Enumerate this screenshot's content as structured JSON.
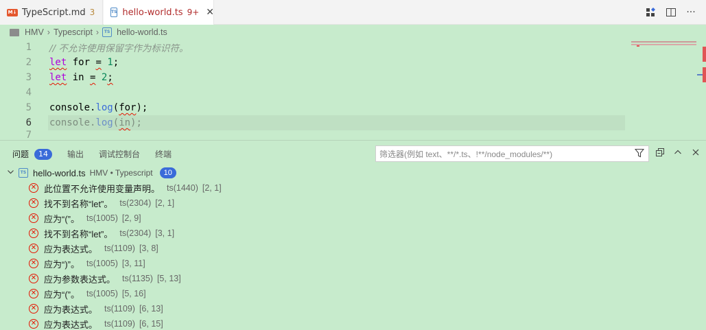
{
  "tabs": [
    {
      "name": "TypeScript.md",
      "badge": "3",
      "icon": "md-icon"
    },
    {
      "name": "hello-world.ts",
      "badge": "9+",
      "icon": "ts-icon",
      "close": "✕"
    }
  ],
  "breadcrumb": [
    "HMV",
    "Typescript",
    "hello-world.ts"
  ],
  "editor": {
    "lines": [
      {
        "num": "1",
        "text": "// 不允许使用保留字作为标识符。"
      },
      {
        "num": "2",
        "kw": "let",
        "id": "for",
        "op": "=",
        "val": "1",
        "end": ";"
      },
      {
        "num": "3",
        "kw": "let",
        "id": "in",
        "op": "=",
        "val": "2",
        "end": ";"
      },
      {
        "num": "4"
      },
      {
        "num": "5",
        "obj": "console",
        "dot": ".",
        "fn": "log",
        "open": "(",
        "arg": "for",
        "close": ");"
      },
      {
        "num": "6",
        "obj": "console",
        "dot": ".",
        "fn": "log",
        "open": "(",
        "arg": "in",
        "close": ");"
      },
      {
        "num": "7"
      }
    ]
  },
  "panel": {
    "tabs": [
      {
        "label": "问题",
        "count": "14"
      },
      {
        "label": "输出"
      },
      {
        "label": "调试控制台"
      },
      {
        "label": "终端"
      }
    ],
    "filter_placeholder": "筛选器(例如 text、**/*.ts、!**/node_modules/**)",
    "file": {
      "name": "hello-world.ts",
      "path": "HMV • Typescript",
      "count": "10"
    },
    "problems": [
      {
        "msg": "此位置不允许使用变量声明。",
        "code": "ts(1440)",
        "pos": "[2, 1]"
      },
      {
        "msg": "找不到名称“let”。",
        "code": "ts(2304)",
        "pos": "[2, 1]"
      },
      {
        "msg": "应为“(”。",
        "code": "ts(1005)",
        "pos": "[2, 9]"
      },
      {
        "msg": "找不到名称“let”。",
        "code": "ts(2304)",
        "pos": "[3, 1]"
      },
      {
        "msg": "应为表达式。",
        "code": "ts(1109)",
        "pos": "[3, 8]"
      },
      {
        "msg": "应为“)”。",
        "code": "ts(1005)",
        "pos": "[3, 11]"
      },
      {
        "msg": "应为参数表达式。",
        "code": "ts(1135)",
        "pos": "[5, 13]"
      },
      {
        "msg": "应为“(”。",
        "code": "ts(1005)",
        "pos": "[5, 16]"
      },
      {
        "msg": "应为表达式。",
        "code": "ts(1109)",
        "pos": "[6, 13]"
      },
      {
        "msg": "应为表达式。",
        "code": "ts(1109)",
        "pos": "[6, 15]"
      }
    ]
  },
  "colors": {
    "background": "#c7ebcc",
    "error": "#e51400",
    "badge": "#3a6bd9"
  }
}
